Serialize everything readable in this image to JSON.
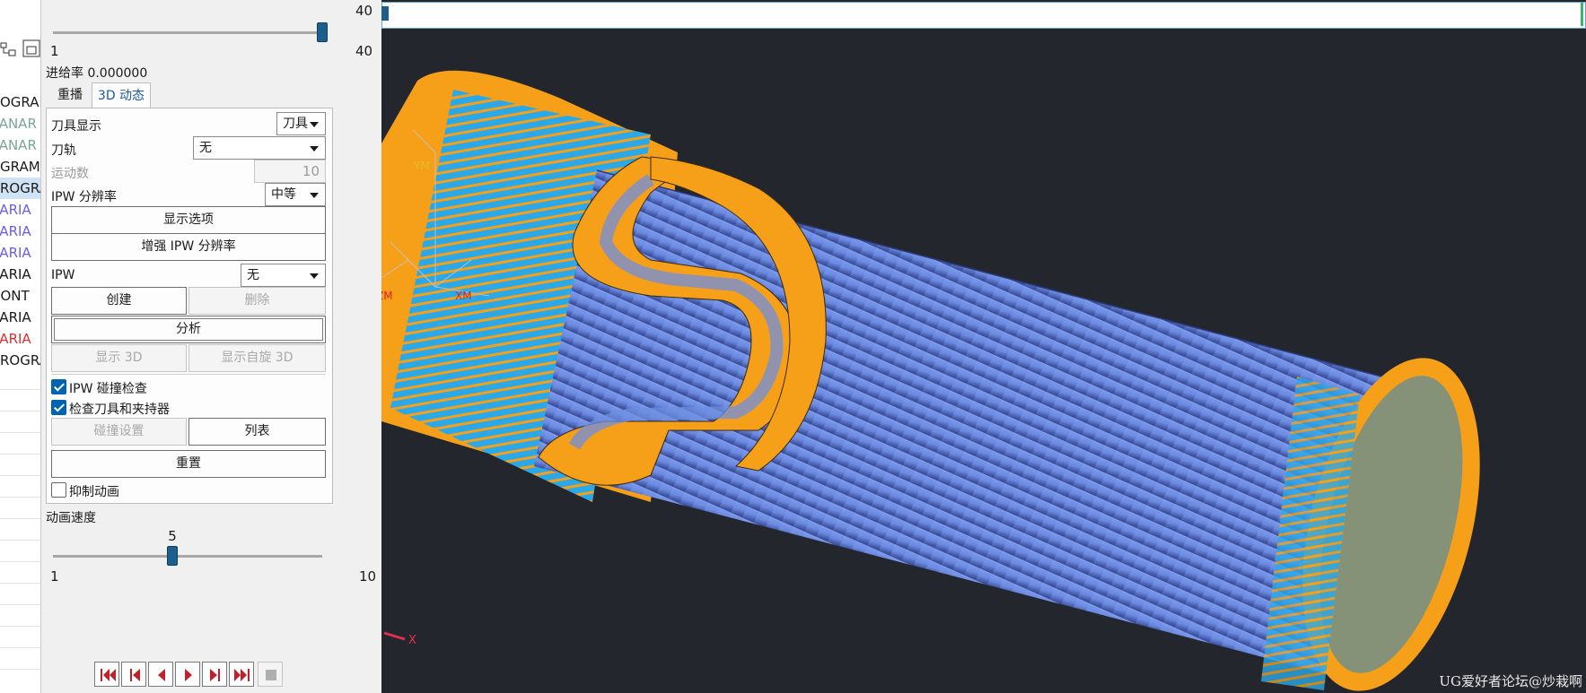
{
  "navigator": {
    "rows": [
      {
        "text": "OGRAM",
        "color": "#1a1a1a"
      },
      {
        "text": "LANAR",
        "color": "#7aa59a"
      },
      {
        "text": "LANAR",
        "color": "#7aa59a"
      },
      {
        "text": "GRAM",
        "color": "#1a1a1a"
      },
      {
        "text": "ROGRA",
        "color": "#1a1a1a"
      },
      {
        "text": "VARIA",
        "color": "#6a5cf0"
      },
      {
        "text": "VARIA",
        "color": "#6a5cf0"
      },
      {
        "text": "VARIA",
        "color": "#6a5cf0"
      },
      {
        "text": "VARIA",
        "color": "#1a1a1a"
      },
      {
        "text": "CONT",
        "color": "#1a1a1a"
      },
      {
        "text": "VARIA",
        "color": "#1a1a1a"
      },
      {
        "text": "VARIA",
        "color": "#e22d2d"
      },
      {
        "text": "ROGRA",
        "color": "#1a1a1a"
      }
    ]
  },
  "top_slider": {
    "value": "40",
    "min": "1",
    "max": "40",
    "fraction": 1.0
  },
  "feed_rate": "进给率 0.000000",
  "tabs": [
    {
      "label": "重播",
      "active": false
    },
    {
      "label": "3D 动态",
      "active": true
    }
  ],
  "panel": {
    "tool_display_label": "刀具显示",
    "tool_display_value": "刀具",
    "toolpath_label": "刀轨",
    "toolpath_value": "无",
    "motion_count_label": "运动数",
    "motion_count_value": "10",
    "ipw_resolution_label": "IPW 分辨率",
    "ipw_resolution_value": "中等",
    "display_options": "显示选项",
    "enhance_ipw": "增强 IPW 分辨率",
    "ipw_label": "IPW",
    "ipw_value": "无",
    "create": "创建",
    "delete": "删除",
    "analyze": "分析",
    "show_3d": "显示 3D",
    "show_free_3d": "显示自旋 3D",
    "ipw_collision": "IPW 碰撞检查",
    "check_tool_holder": "检查刀具和夹持器",
    "collision_settings": "碰撞设置",
    "list": "列表",
    "reset": "重置",
    "suppress_animation": "抑制动画"
  },
  "animation_speed": {
    "label": "动画速度",
    "value": "5",
    "min": "1",
    "max": "10",
    "fraction": 0.444
  },
  "playback": [
    "skip-start",
    "step-back",
    "play-reverse",
    "play-forward",
    "step-forward",
    "skip-end",
    "stop"
  ],
  "viewport": {
    "axis_labels": {
      "ym": "YM",
      "xm": "XM",
      "zm": "ZM",
      "x": "X"
    },
    "watermark": "UG爱好者论坛@炒栽啊"
  },
  "colors": {
    "stock_orange": "#f6a019",
    "part_blue": "#6f8fe0",
    "machined_cyan": "#2aa8e8",
    "viewport_bg": "#23262c",
    "accent": "#0063b1"
  }
}
